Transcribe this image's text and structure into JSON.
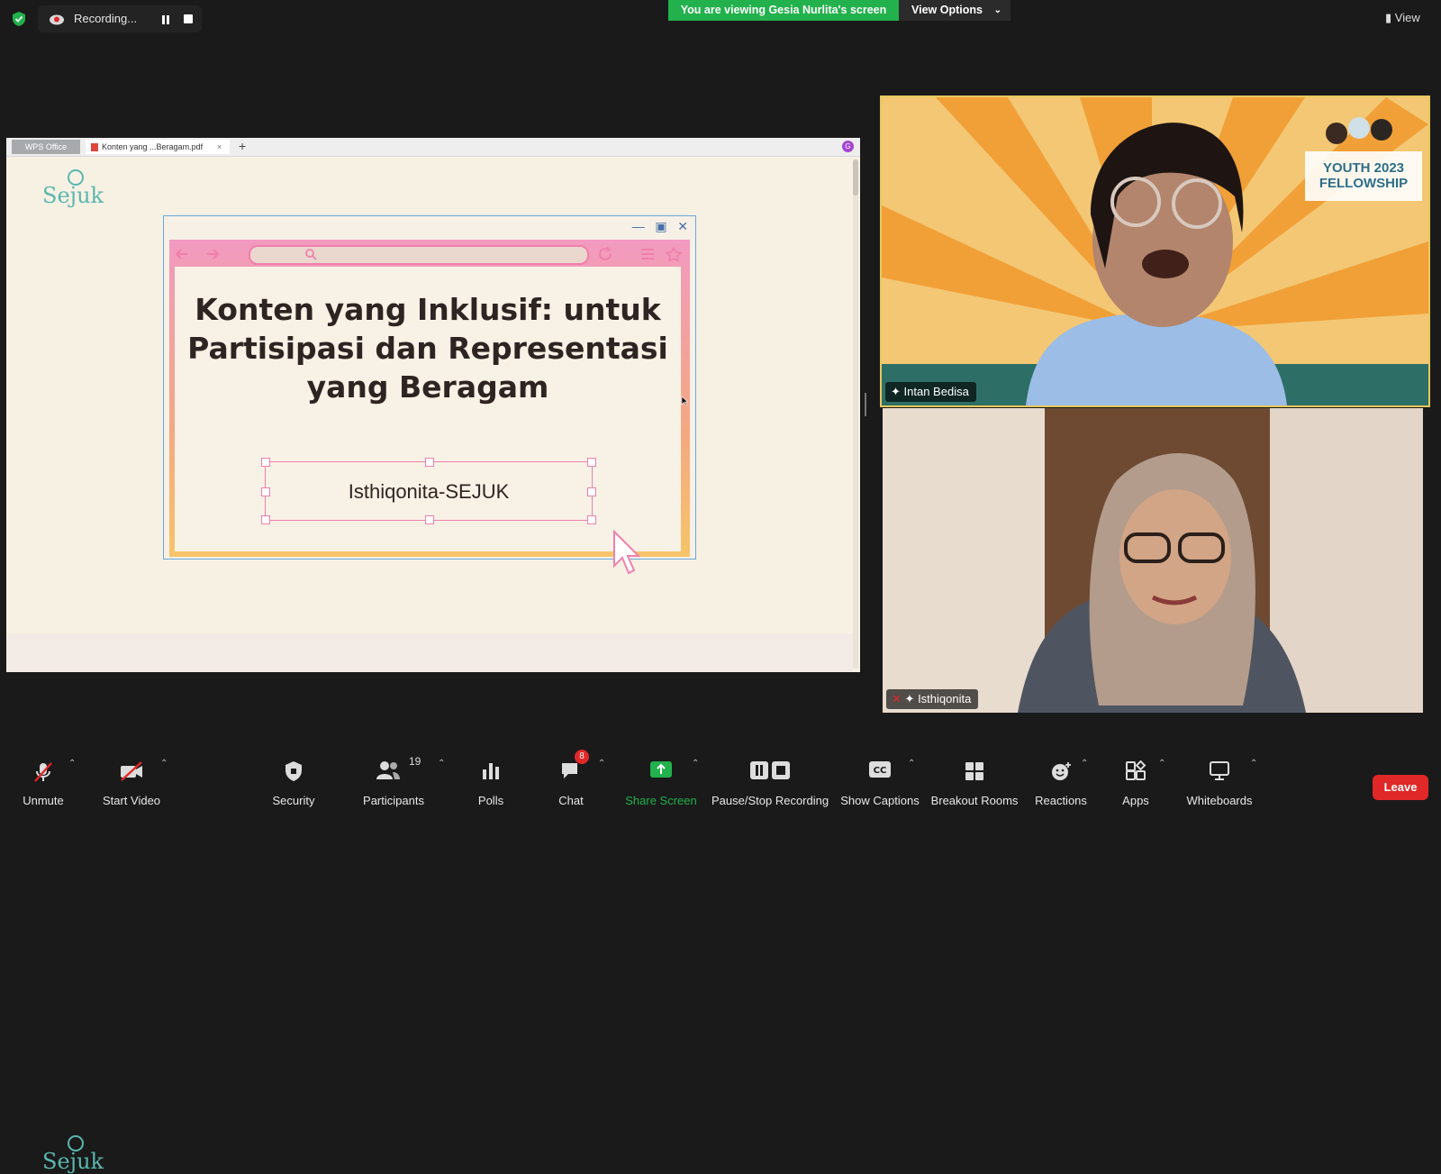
{
  "recording": {
    "label": "Recording..."
  },
  "banner": {
    "viewing_text": "You are viewing Gesia Nurlita's screen",
    "view_options": "View Options"
  },
  "top_right": {
    "view_label": "View"
  },
  "shared_screen": {
    "wps_tab": "WPS Office",
    "pdf_tab": "Konten yang ...Beragam.pdf",
    "avatar_letter": "G",
    "logo_text": "Sejuk",
    "slide": {
      "title": "Konten yang Inklusif: untuk Partisipasi dan Representasi yang Beragam",
      "author": "Isthiqonita-SEJUK"
    }
  },
  "participants_video": [
    {
      "name": "Intan Bedisa",
      "badge_text": "YOUTH 2023 FELLOWSHIP"
    },
    {
      "name": "Isthiqonita"
    }
  ],
  "toolbar": {
    "unmute": "Unmute",
    "start_video": "Start Video",
    "security": "Security",
    "participants": "Participants",
    "participants_count": "19",
    "polls": "Polls",
    "chat": "Chat",
    "chat_badge": "8",
    "share_screen": "Share Screen",
    "pause_stop": "Pause/Stop Recording",
    "captions": "Show Captions",
    "breakout": "Breakout Rooms",
    "reactions": "Reactions",
    "apps": "Apps",
    "whiteboards": "Whiteboards",
    "leave": "Leave"
  },
  "colors": {
    "share_green": "#22b14c",
    "leave_red": "#e02828",
    "highlight_border": "#e7c85d",
    "slide_pink": "#f07fac"
  }
}
